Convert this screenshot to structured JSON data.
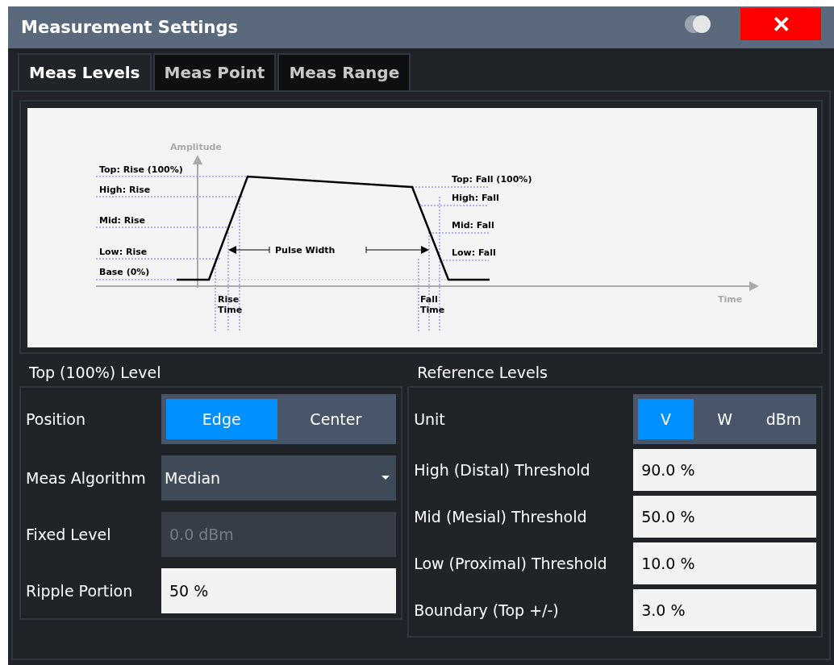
{
  "window": {
    "title": "Measurement Settings",
    "close_label": "✕"
  },
  "tabs": [
    {
      "label": "Meas Levels",
      "selected": true
    },
    {
      "label": "Meas Point",
      "selected": false
    },
    {
      "label": "Meas Range",
      "selected": false
    }
  ],
  "diagram": {
    "axis_y": "Amplitude",
    "axis_x": "Time",
    "pulse_width": "Pulse Width",
    "rise_labels": [
      "Top: Rise (100%)",
      "High: Rise",
      "Mid: Rise",
      "Low: Rise",
      "Base (0%)"
    ],
    "fall_labels": [
      "Top: Fall (100%)",
      "High: Fall",
      "Mid: Fall",
      "Low: Fall"
    ],
    "rise_time": [
      "Rise",
      "Time"
    ],
    "fall_time": [
      "Fall",
      "Time"
    ]
  },
  "top_level": {
    "title": "Top (100%) Level",
    "rows": [
      {
        "kind": "toggle",
        "label": "Position",
        "options": [
          {
            "label": "Edge",
            "selected": true
          },
          {
            "label": "Center",
            "selected": false
          }
        ]
      },
      {
        "kind": "dropdown",
        "label": "Meas Algorithm",
        "value": "Median"
      },
      {
        "kind": "field",
        "label": "Fixed Level",
        "value": "0.0 dBm",
        "disabled": true
      },
      {
        "kind": "field",
        "label": "Ripple Portion",
        "value": "50 %",
        "disabled": false
      }
    ]
  },
  "reference_levels": {
    "title": "Reference Levels",
    "rows": [
      {
        "kind": "toggle",
        "label": "Unit",
        "options": [
          {
            "label": "V",
            "selected": true
          },
          {
            "label": "W",
            "selected": false
          },
          {
            "label": "dBm",
            "selected": false
          }
        ]
      },
      {
        "kind": "field",
        "label": "High (Distal) Threshold",
        "value": "90.0 %",
        "disabled": false
      },
      {
        "kind": "field",
        "label": "Mid (Mesial) Threshold",
        "value": "50.0 %",
        "disabled": false
      },
      {
        "kind": "field",
        "label": "Low (Proximal) Threshold",
        "value": "10.0 %",
        "disabled": false
      },
      {
        "kind": "field",
        "label": "Boundary (Top +/-)",
        "value": "3.0 %",
        "disabled": false
      }
    ]
  }
}
